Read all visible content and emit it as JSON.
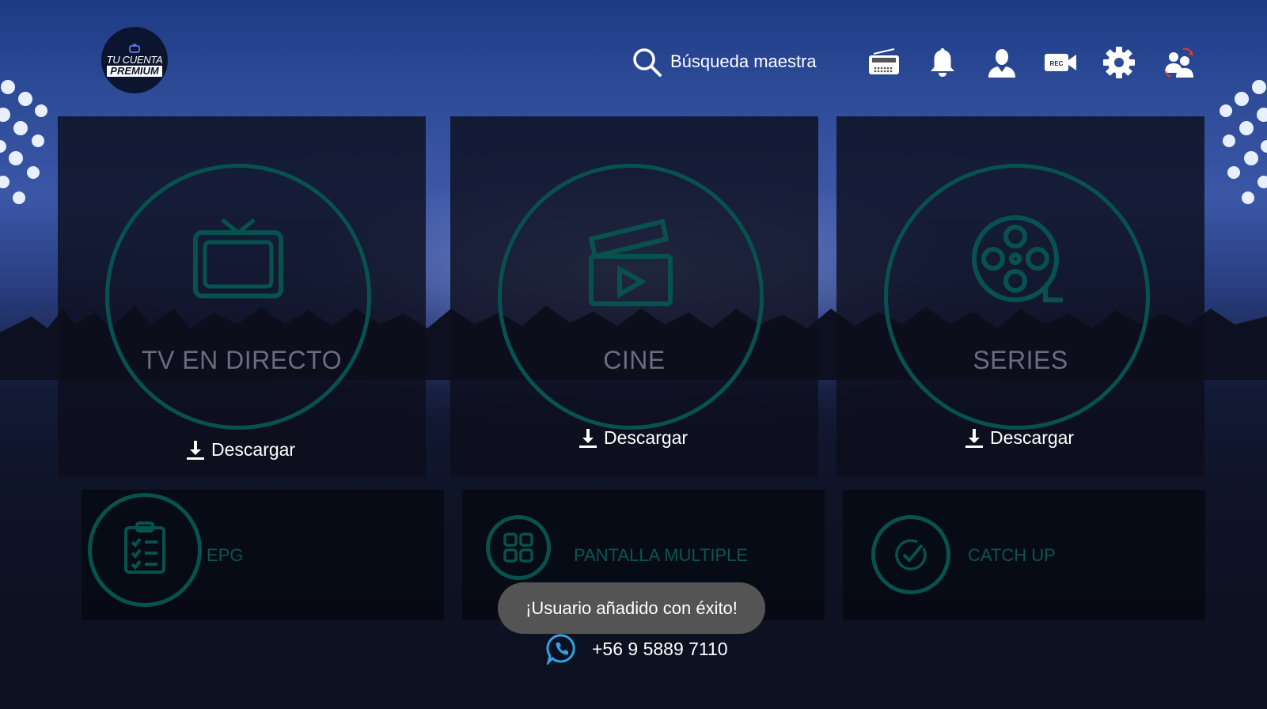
{
  "logo": {
    "line1": "TU CUENTA",
    "line2": "PREMIUM"
  },
  "header": {
    "search_label": "Búsqueda maestra",
    "icons": [
      "radio-icon",
      "bell-icon",
      "user-icon",
      "rec-camera-icon",
      "gear-icon",
      "switch-user-icon"
    ],
    "rec_text": "REC"
  },
  "cards": [
    {
      "title": "TV EN DIRECTO",
      "action": "Descargar",
      "icon": "tv-icon"
    },
    {
      "title": "CINE",
      "action": "Descargar",
      "icon": "clapperboard-icon"
    },
    {
      "title": "SERIES",
      "action": "Descargar",
      "icon": "film-reel-icon"
    }
  ],
  "small_cards": [
    {
      "label": "EPG",
      "icon": "clipboard-checklist-icon"
    },
    {
      "label": "PANTALLA MULTIPLE",
      "icon": "grid-icon"
    },
    {
      "label": "CATCH UP",
      "icon": "check-circle-icon"
    }
  ],
  "toast": "¡Usuario añadido con éxito!",
  "contact": {
    "phone": "+56 9 5889 7110",
    "icon": "whatsapp-icon"
  },
  "colors": {
    "accent_teal": "#07524e",
    "background": "#0d1122",
    "toast_bg": "#545454"
  }
}
